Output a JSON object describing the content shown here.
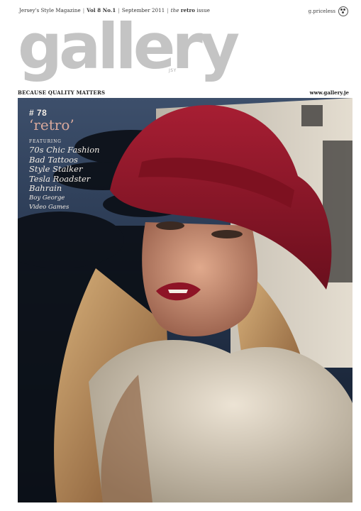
{
  "header": {
    "magazine_desc": "Jersey's Style Magazine",
    "volume": "Vol 8 No.1",
    "date": "September 2011",
    "issue_prefix": "the",
    "issue_word": "retro",
    "issue_suffix": "issue",
    "priceless": "g.priceless"
  },
  "masthead": {
    "title": "gallery",
    "suffix": "JSY"
  },
  "subheader": {
    "tagline": "BECAUSE QUALITY MATTERS",
    "website": "www.gallery.je"
  },
  "cover": {
    "issue_number": "# 78",
    "theme": "‘retro’",
    "featuring_label": "FEATURING",
    "features_large": [
      "70s Chic Fashion",
      "Bad Tattoos",
      "Style Stalker",
      "Tesla Roadster",
      "Bahrain"
    ],
    "features_small": [
      "Boy George",
      "Video Games"
    ]
  },
  "colors": {
    "masthead": "#c4c4c4",
    "hat": "#9e1b2f",
    "sky": "#2a3a52",
    "coverline_text": "#f3ede6",
    "theme_text": "#d9a99c"
  }
}
